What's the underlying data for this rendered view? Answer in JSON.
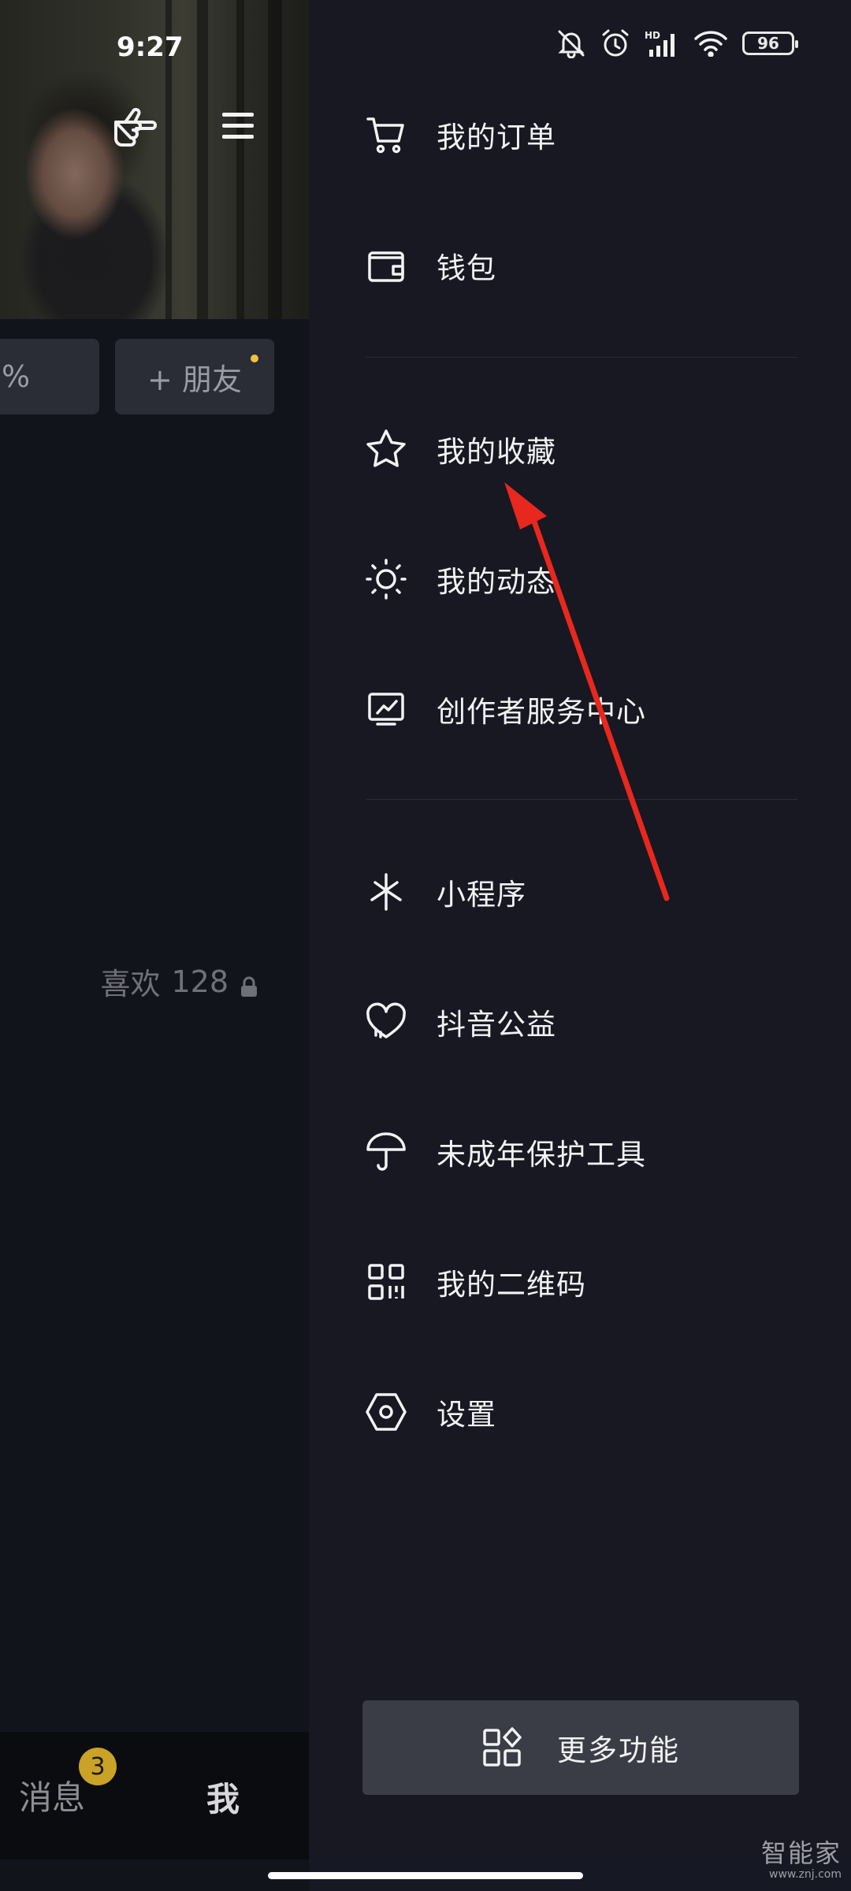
{
  "status_bar": {
    "time": "9:27",
    "battery": "96",
    "network": "HD"
  },
  "profile": {
    "pill_partial": "%",
    "add_friend": "+ 朋友",
    "likes_label": "喜欢",
    "likes_count": "128"
  },
  "bottom_nav": {
    "messages": "消息",
    "messages_badge": "3",
    "me": "我"
  },
  "drawer": {
    "items": [
      {
        "label": "我的订单",
        "icon": "cart-icon"
      },
      {
        "label": "钱包",
        "icon": "wallet-icon"
      },
      {
        "label": "我的收藏",
        "icon": "star-icon"
      },
      {
        "label": "我的动态",
        "icon": "sun-icon"
      },
      {
        "label": "创作者服务中心",
        "icon": "creator-chart-icon"
      },
      {
        "label": "小程序",
        "icon": "mini-program-icon"
      },
      {
        "label": "抖音公益",
        "icon": "heart-charity-icon"
      },
      {
        "label": "未成年保护工具",
        "icon": "umbrella-icon"
      },
      {
        "label": "我的二维码",
        "icon": "qrcode-icon"
      },
      {
        "label": "设置",
        "icon": "hexagon-settings-icon"
      }
    ],
    "more_button": "更多功能"
  },
  "watermark": {
    "cn": "智能家",
    "en": "www.znj.com"
  },
  "colors": {
    "drawer_bg": "#171821",
    "annotation_arrow": "#e8281e",
    "badge": "#c9a227"
  }
}
